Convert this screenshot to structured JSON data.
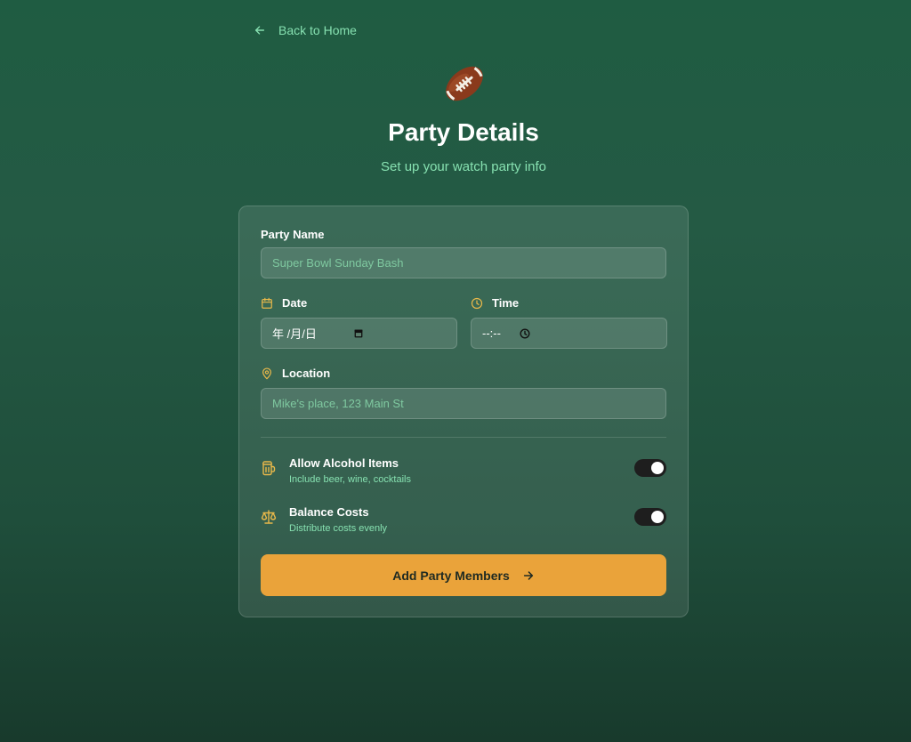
{
  "nav": {
    "back_label": "Back to Home"
  },
  "header": {
    "title": "Party Details",
    "subtitle": "Set up your watch party info",
    "icon": "football-icon"
  },
  "form": {
    "party_name": {
      "label": "Party Name",
      "placeholder": "Super Bowl Sunday Bash"
    },
    "date": {
      "label": "Date",
      "value": "年 /月/日",
      "icon": "calendar-icon"
    },
    "time": {
      "label": "Time",
      "value": "--:--",
      "icon": "clock-icon"
    },
    "location": {
      "label": "Location",
      "placeholder": "Mike's place, 123 Main St",
      "icon": "map-pin-icon"
    },
    "toggles": [
      {
        "title": "Allow Alcohol Items",
        "description": "Include beer, wine, cocktails",
        "enabled": true,
        "icon": "beer-mug-icon"
      },
      {
        "title": "Balance Costs",
        "description": "Distribute costs evenly",
        "enabled": true,
        "icon": "scale-icon"
      }
    ],
    "submit_label": "Add Party Members"
  },
  "colors": {
    "accent": "#eaa33a",
    "icon_gold": "#e8b84a",
    "mint_text": "#86e0b0",
    "background": "#1f5c42"
  }
}
